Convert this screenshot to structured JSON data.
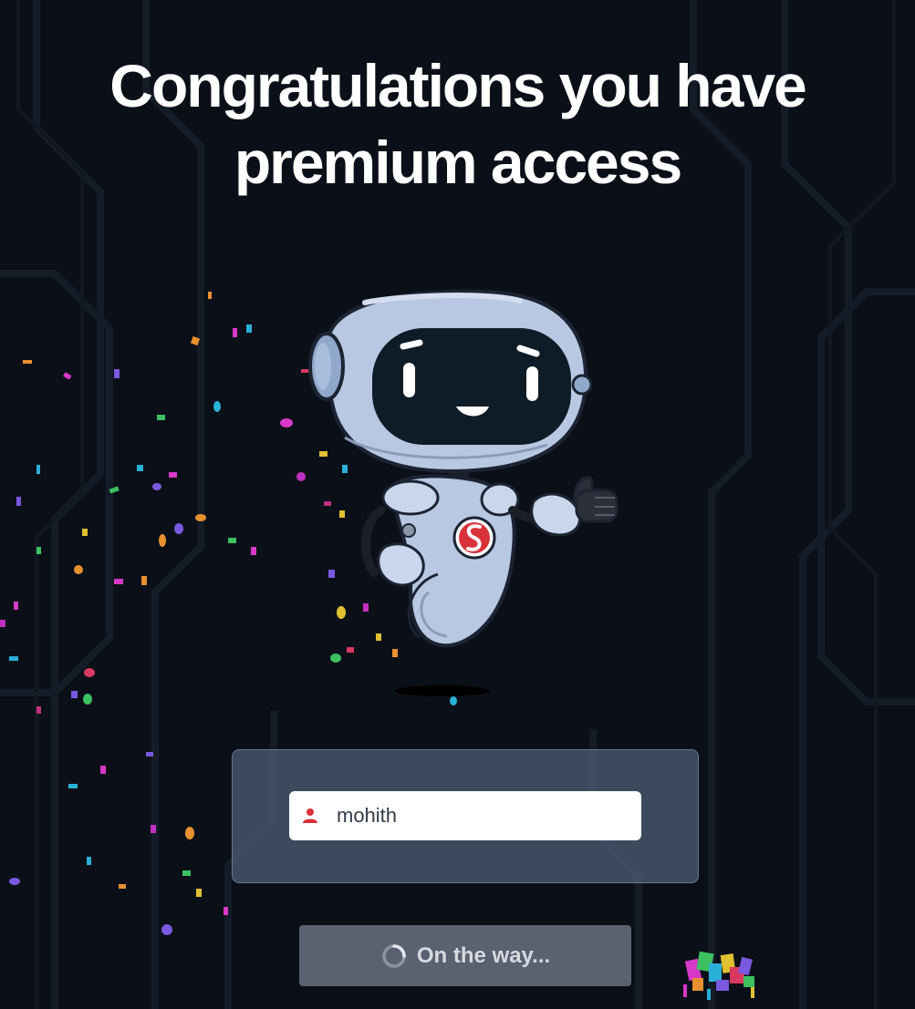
{
  "heading": {
    "line1": "Congratulations you have",
    "line2": "premium access"
  },
  "form": {
    "name_value": "mohith",
    "user_icon": "user-icon"
  },
  "cta": {
    "label": "On the way...",
    "icon": "spinner-icon",
    "disabled": true
  },
  "robot": {
    "badge_icon": "brand-s-logo",
    "gesture": "thumbs-up"
  },
  "colors": {
    "background": "#0b1018",
    "accent_red": "#d8323a",
    "panel": "#4c5a72",
    "button": "#5a6170"
  }
}
